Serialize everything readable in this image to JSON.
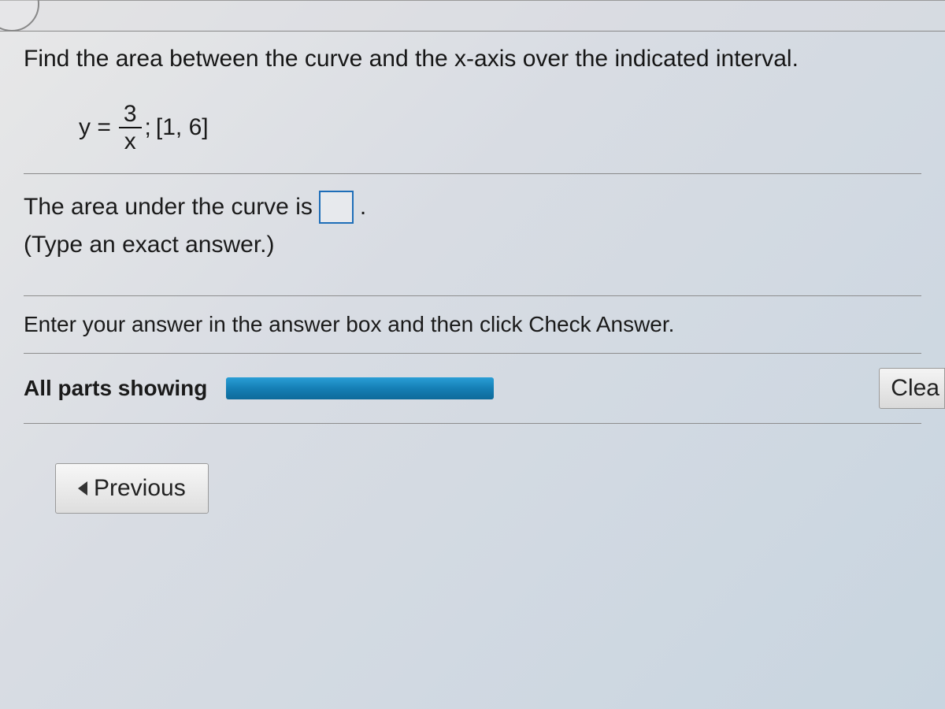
{
  "question": {
    "prompt": "Find the area between the curve and the x-axis over the indicated interval.",
    "equation_lhs": "y =",
    "fraction_num": "3",
    "fraction_den": "x",
    "equation_suffix": ";",
    "interval": "[1, 6]"
  },
  "answer_section": {
    "prefix": "The area under the curve is",
    "suffix": ".",
    "hint": "(Type an exact answer.)",
    "input_value": ""
  },
  "instruction": "Enter your answer in the answer box and then click Check Answer.",
  "parts": {
    "label": "All parts showing",
    "progress_percent": 100
  },
  "buttons": {
    "clear": "Clea",
    "previous": "Previous"
  }
}
